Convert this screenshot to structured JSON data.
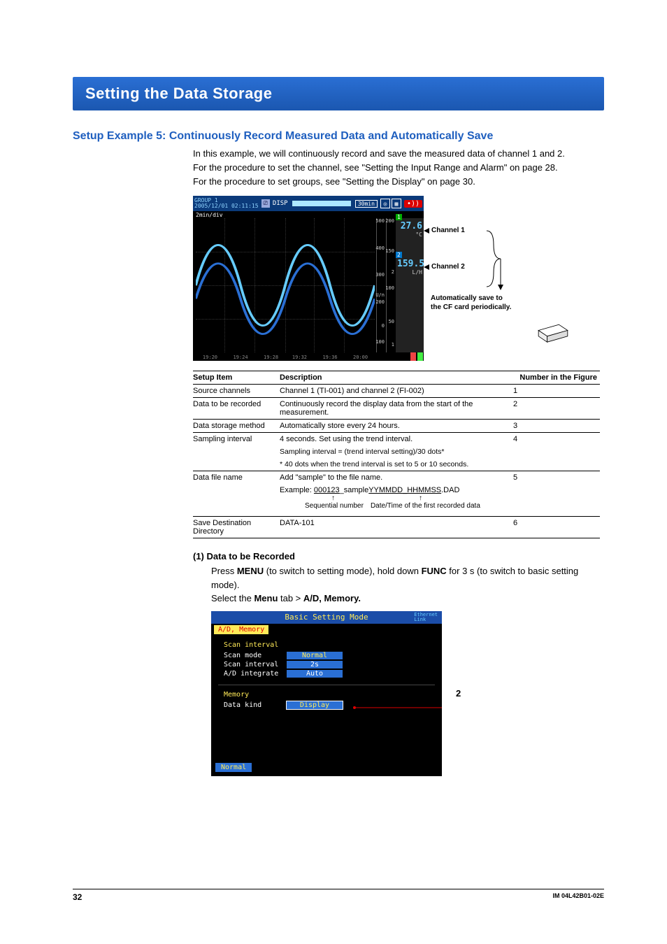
{
  "title_bar": "Setting the Data Storage",
  "h2": "Setup Example 5: Continuously Record Measured Data and Automatically Save",
  "intro": [
    "In this example, we will continuously record and save the measured data of channel 1 and 2.",
    "For the procedure to set the channel, see \"Setting the Input Range and Alarm\" on page 28.",
    "For the procedure to set groups, see \"Setting the Display\" on page 30."
  ],
  "trend_header": {
    "group": "GROUP 1",
    "datetime": "2005/12/01 02:11:15",
    "disp": "DISP",
    "interval": "30min",
    "time_div": "2min/div",
    "alarm": "•))"
  },
  "trend_ticks": [
    "19:20",
    "19:24",
    "19:28",
    "19:32",
    "19:36",
    "20:00"
  ],
  "scale1": [
    "500",
    "400",
    "300",
    "U/n",
    "200",
    "0",
    "100"
  ],
  "scale2": [
    "200",
    "150",
    "2",
    "100",
    "50",
    "1"
  ],
  "reading1": {
    "idx": "1",
    "val": "27.6",
    "unit": "°C"
  },
  "reading2": {
    "idx": "2",
    "val": "159.5",
    "unit": "L/H"
  },
  "callout_ch1": "Channel 1",
  "callout_ch2": "Channel 2",
  "callout_cf_l1": "Automatically save to",
  "callout_cf_l2": "the CF card periodically.",
  "table": {
    "head": [
      "Setup Item",
      "Description",
      "Number in the Figure"
    ],
    "rows": [
      {
        "item": "Source channels",
        "desc": [
          "Channel 1 (TI-001) and channel 2 (FI-002)"
        ],
        "num": "1"
      },
      {
        "item": "Data to be recorded",
        "desc": [
          "Continuously record the display data from the start of the measurement."
        ],
        "num": "2"
      },
      {
        "item": "Data storage method",
        "desc": [
          "Automatically store every 24 hours."
        ],
        "num": "3"
      },
      {
        "item": "Sampling interval",
        "desc": [
          "4 seconds. Set using the trend interval.",
          "Sampling interval = (trend interval setting)/30 dots*",
          "* 40 dots when the trend interval is set to 5 or 10 seconds."
        ],
        "num": "4"
      },
      {
        "item": "Data file name",
        "desc": [
          "Add \"sample\" to the file name.",
          "Example: 000123_sampleYYMMDD_HHMMSS.DAD"
        ],
        "num": "5",
        "footnote": true
      },
      {
        "item": "Save Destination Directory",
        "desc": [
          "DATA-101"
        ],
        "num": "6"
      }
    ],
    "seq_label": "Sequential number",
    "dt_label": "Date/Time of the first recorded data"
  },
  "section1": {
    "head": "(1) Data to be Recorded",
    "p1a": "Press ",
    "p1b": "MENU",
    "p1c": " (to switch to setting mode), hold down ",
    "p1d": "FUNC",
    "p1e": " for 3 s (to switch to basic setting mode).",
    "p2a": "Select the ",
    "p2b": "Menu",
    "p2c": " tab > ",
    "p2d": "A/D, Memory."
  },
  "bsm": {
    "title": "Basic Setting Mode",
    "eth": "Ethernet\nLink",
    "tab": "A/D, Memory",
    "grp1": "Scan interval",
    "rows1": [
      {
        "k": "Scan mode",
        "v": "Normal"
      },
      {
        "k": "Scan interval",
        "v": "2s"
      },
      {
        "k": "A/D integrate",
        "v": "Auto"
      }
    ],
    "grp2": "Memory",
    "rows2": [
      {
        "k": "Data kind",
        "v": "Display"
      }
    ],
    "footer": "Normal",
    "callout": "2"
  },
  "footer": {
    "page": "32",
    "doc": "IM 04L42B01-02E"
  }
}
